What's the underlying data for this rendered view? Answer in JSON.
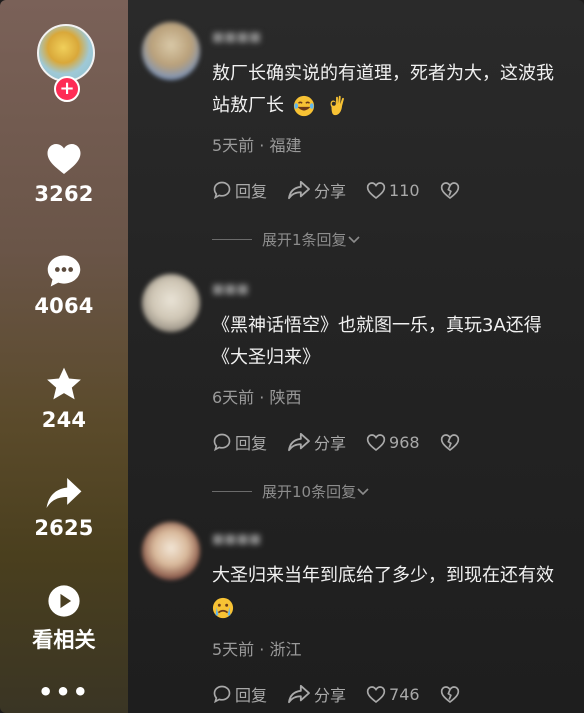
{
  "rail": {
    "follow_symbol": "+",
    "likes": "3262",
    "comments": "4064",
    "favorites": "244",
    "shares": "2625",
    "related_label": "看相关",
    "more_symbol": "•••"
  },
  "comments": [
    {
      "text_line1": "敖厂长确实说的有道理，死者为大，这波我",
      "text_line2": "站敖厂长",
      "emojis": [
        "laughing-tears",
        "ok-hand"
      ],
      "meta": "5天前 · 福建",
      "reply_label": "回复",
      "share_label": "分享",
      "like_count": "110",
      "expand_label": "展开1条回复"
    },
    {
      "text_line1": "《黑神话悟空》也就图一乐，真玩3A还得",
      "text_line2": "《大圣归来》",
      "meta": "6天前 · 陕西",
      "reply_label": "回复",
      "share_label": "分享",
      "like_count": "968",
      "expand_label": "展开10条回复"
    },
    {
      "text_line1": "大圣归来当年到底给了多少，到现在还有效",
      "emojis": [
        "crying-face"
      ],
      "meta": "5天前 · 浙江",
      "reply_label": "回复",
      "share_label": "分享",
      "like_count": "746"
    }
  ],
  "colors": {
    "accent": "#fe2c55",
    "text": "#f1f1f1",
    "muted": "#9a9a9a"
  }
}
